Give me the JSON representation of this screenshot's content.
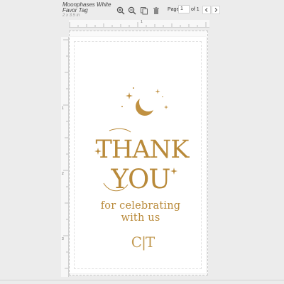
{
  "document": {
    "title": "Moonphases White Favor Tag",
    "size": "2 x 3.5 in"
  },
  "toolbar": {
    "icons": [
      "zoom-in-icon",
      "zoom-out-icon",
      "duplicate-icon",
      "trash-icon"
    ],
    "page_label": "Page",
    "page_value": "1",
    "page_of": "of 1"
  },
  "rulers": {
    "horizontal": [
      "1"
    ],
    "vertical": [
      "1",
      "2",
      "3"
    ]
  },
  "card": {
    "heading_line1": "THANK",
    "heading_line2": "YOU",
    "tagline_line1": "for celebrating",
    "tagline_line2": "with us",
    "monogram": "C|T",
    "accent_color": "#b98a3a",
    "decorations": [
      "crescent-moon-icon",
      "sparkle-icon"
    ]
  }
}
